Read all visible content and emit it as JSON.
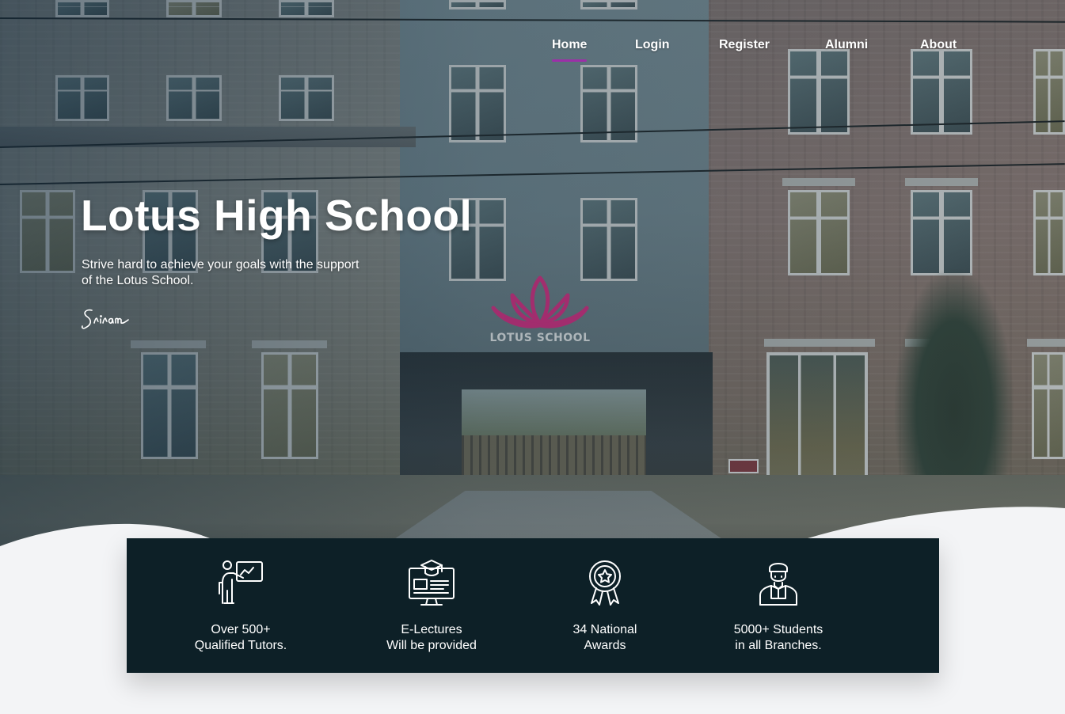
{
  "nav": {
    "items": [
      {
        "label": "Home",
        "active": true
      },
      {
        "label": "Login",
        "active": false
      },
      {
        "label": "Register",
        "active": false
      },
      {
        "label": "Alumni",
        "active": false
      },
      {
        "label": "About",
        "active": false
      }
    ],
    "active_color": "#9c2fa8"
  },
  "hero": {
    "title": "Lotus High School",
    "subtitle": "Strive hard to achieve your goals with the support of the Lotus School.",
    "signature": "Sriram",
    "logo_text": "LOTUS SCHOOL",
    "logo_color": "#b0246e"
  },
  "stats": {
    "background": "#0d2027",
    "items": [
      {
        "icon": "tutor-whiteboard-icon",
        "line1": "Over 500+",
        "line2": "Qualified Tutors."
      },
      {
        "icon": "e-lecture-monitor-icon",
        "line1": "E-Lectures",
        "line2": "Will be provided"
      },
      {
        "icon": "award-medal-icon",
        "line1": "34 National",
        "line2": "Awards"
      },
      {
        "icon": "student-icon",
        "line1": "5000+ Students",
        "line2": "in all Branches."
      }
    ]
  }
}
